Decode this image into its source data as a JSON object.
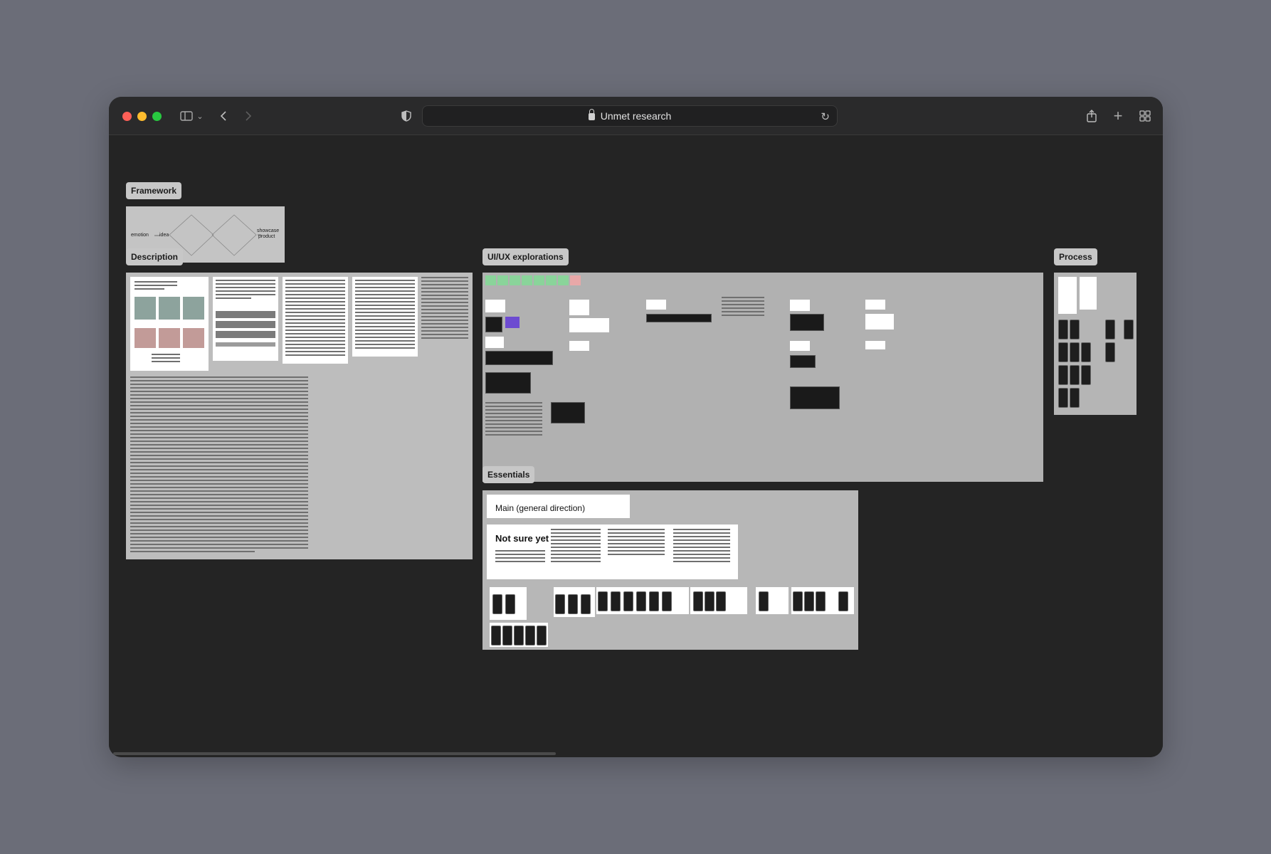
{
  "browser": {
    "title": "Unmet research"
  },
  "sections": {
    "framework": {
      "label": "Framework",
      "diagram": {
        "emotion": "emotion",
        "idea": "idea",
        "showcase": "showcase",
        "product": "product"
      }
    },
    "description": {
      "label": "Description"
    },
    "uiux": {
      "label": "UI/UX explorations"
    },
    "process": {
      "label": "Process"
    },
    "essentials": {
      "label": "Essentials",
      "main": "Main (general direction)",
      "not_sure": "Not sure yet"
    }
  },
  "icons": {
    "sidebar": "sidebar-icon",
    "back": "chevron-left-icon",
    "forward": "chevron-right-icon",
    "shield": "shield-icon",
    "lock": "lock-icon",
    "reload": "reload-icon",
    "share": "share-icon",
    "new_tab": "plus-icon",
    "tabs": "tab-overview-icon"
  },
  "colors": {
    "canvas": "#242424",
    "section": "#b8b8b8",
    "label": "#c7c7c7"
  }
}
